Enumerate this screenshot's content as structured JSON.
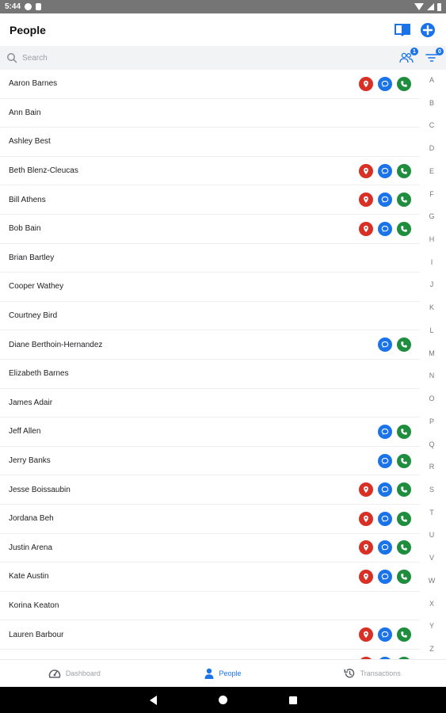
{
  "status_bar": {
    "time": "5:44"
  },
  "header": {
    "title": "People"
  },
  "search": {
    "placeholder": "Search",
    "people_filter_count": "1",
    "filter_count": "0"
  },
  "contacts": [
    {
      "name": "Aaron Barnes",
      "location": true,
      "message": true,
      "call": true
    },
    {
      "name": "Ann Bain",
      "location": false,
      "message": false,
      "call": false
    },
    {
      "name": "Ashley Best",
      "location": false,
      "message": false,
      "call": false
    },
    {
      "name": "Beth Blenz-Cleucas",
      "location": true,
      "message": true,
      "call": true
    },
    {
      "name": "Bill Athens",
      "location": true,
      "message": true,
      "call": true
    },
    {
      "name": "Bob Bain",
      "location": true,
      "message": true,
      "call": true
    },
    {
      "name": "Brian Bartley",
      "location": false,
      "message": false,
      "call": false
    },
    {
      "name": "Cooper Wathey",
      "location": false,
      "message": false,
      "call": false
    },
    {
      "name": "Courtney Bird",
      "location": false,
      "message": false,
      "call": false
    },
    {
      "name": "Diane Berthoin-Hernandez",
      "location": false,
      "message": true,
      "call": true
    },
    {
      "name": "Elizabeth Barnes",
      "location": false,
      "message": false,
      "call": false
    },
    {
      "name": "James Adair",
      "location": false,
      "message": false,
      "call": false
    },
    {
      "name": "Jeff Allen",
      "location": false,
      "message": true,
      "call": true
    },
    {
      "name": "Jerry Banks",
      "location": false,
      "message": true,
      "call": true
    },
    {
      "name": "Jesse Boissaubin",
      "location": true,
      "message": true,
      "call": true
    },
    {
      "name": "Jordana Beh",
      "location": true,
      "message": true,
      "call": true
    },
    {
      "name": "Justin Arena",
      "location": true,
      "message": true,
      "call": true
    },
    {
      "name": "Kate Austin",
      "location": true,
      "message": true,
      "call": true
    },
    {
      "name": "Korina Keaton",
      "location": false,
      "message": false,
      "call": false
    },
    {
      "name": "Lauren Barbour",
      "location": true,
      "message": true,
      "call": true
    },
    {
      "name": "",
      "location": true,
      "message": true,
      "call": true
    }
  ],
  "alphabet": [
    "A",
    "B",
    "C",
    "D",
    "E",
    "F",
    "G",
    "H",
    "I",
    "J",
    "K",
    "L",
    "M",
    "N",
    "O",
    "P",
    "Q",
    "R",
    "S",
    "T",
    "U",
    "V",
    "W",
    "X",
    "Y",
    "Z"
  ],
  "bottom_nav": [
    {
      "label": "Dashboard",
      "icon": "dashboard-gauge-icon",
      "active": false
    },
    {
      "label": "People",
      "icon": "person-icon",
      "active": true
    },
    {
      "label": "Transactions",
      "icon": "history-icon",
      "active": false
    }
  ],
  "colors": {
    "accent": "#1a73e8",
    "location": "#d93025",
    "call": "#1e8e3e"
  }
}
